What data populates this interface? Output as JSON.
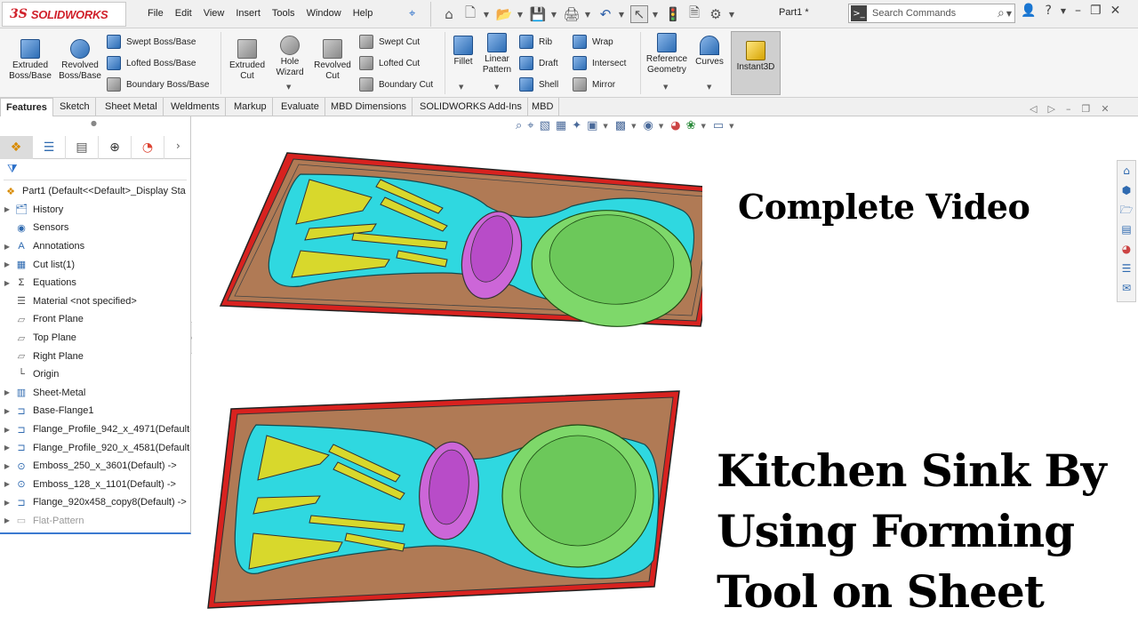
{
  "app": {
    "logo_ds": "3S",
    "logo_name": "SOLIDWORKS",
    "document_title": "Part1 *"
  },
  "menu": [
    "File",
    "Edit",
    "View",
    "Insert",
    "Tools",
    "Window",
    "Help"
  ],
  "search": {
    "placeholder": "Search Commands"
  },
  "ribbon": {
    "extruded_boss": "Extruded\nBoss/Base",
    "revolved_boss": "Revolved\nBoss/Base",
    "swept_boss": "Swept Boss/Base",
    "lofted_boss": "Lofted Boss/Base",
    "boundary_boss": "Boundary Boss/Base",
    "extruded_cut": "Extruded\nCut",
    "hole_wizard": "Hole\nWizard",
    "revolved_cut": "Revolved\nCut",
    "swept_cut": "Swept Cut",
    "lofted_cut": "Lofted Cut",
    "boundary_cut": "Boundary Cut",
    "fillet": "Fillet",
    "linear_pattern": "Linear\nPattern",
    "rib": "Rib",
    "draft": "Draft",
    "shell": "Shell",
    "wrap": "Wrap",
    "intersect": "Intersect",
    "mirror": "Mirror",
    "reference_geometry": "Reference\nGeometry",
    "curves": "Curves",
    "instant3d": "Instant3D"
  },
  "tabs": [
    "Features",
    "Sketch",
    "Sheet Metal",
    "Weldments",
    "Markup",
    "Evaluate",
    "MBD Dimensions",
    "SOLIDWORKS Add-Ins",
    "MBD"
  ],
  "tree": [
    {
      "label": "Part1  (Default<<Default>_Display Sta",
      "icon": "part-icon",
      "root": true
    },
    {
      "label": "History",
      "icon": "history-icon"
    },
    {
      "label": "Sensors",
      "icon": "sensors-icon"
    },
    {
      "label": "Annotations",
      "icon": "annotations-icon"
    },
    {
      "label": "Cut list(1)",
      "icon": "cut-list-icon"
    },
    {
      "label": "Equations",
      "icon": "equations-icon"
    },
    {
      "label": "Material <not specified>",
      "icon": "material-icon"
    },
    {
      "label": "Front Plane",
      "icon": "plane-icon"
    },
    {
      "label": "Top Plane",
      "icon": "plane-icon"
    },
    {
      "label": "Right Plane",
      "icon": "plane-icon"
    },
    {
      "label": "Origin",
      "icon": "origin-icon"
    },
    {
      "label": "Sheet-Metal",
      "icon": "sheet-metal-icon"
    },
    {
      "label": "Base-Flange1",
      "icon": "base-flange-icon"
    },
    {
      "label": "Flange_Profile_942_x_4971(Default",
      "icon": "flange-icon"
    },
    {
      "label": "Flange_Profile_920_x_4581(Default",
      "icon": "flange-icon"
    },
    {
      "label": "Emboss_250_x_3601(Default) ->",
      "icon": "emboss-icon"
    },
    {
      "label": "Emboss_128_x_1101(Default) ->",
      "icon": "emboss-icon"
    },
    {
      "label": "Flange_920x458_copy8(Default) ->",
      "icon": "flange-icon"
    },
    {
      "label": "Flat-Pattern",
      "icon": "flat-pattern-icon",
      "dim": true
    }
  ],
  "overlay": {
    "line1": "Complete Video",
    "line2": "Kitchen Sink By",
    "line3": "Using Forming",
    "line4": "Tool on Sheet"
  },
  "colors": {
    "flange_red": "#d8221f",
    "sheet_brown": "#b07a55",
    "basin_cyan": "#2fd8e0",
    "emboss_yellow": "#d8d82c",
    "small_bowl_magenta": "#cc66d8",
    "large_bowl_green": "#7ed86a"
  }
}
